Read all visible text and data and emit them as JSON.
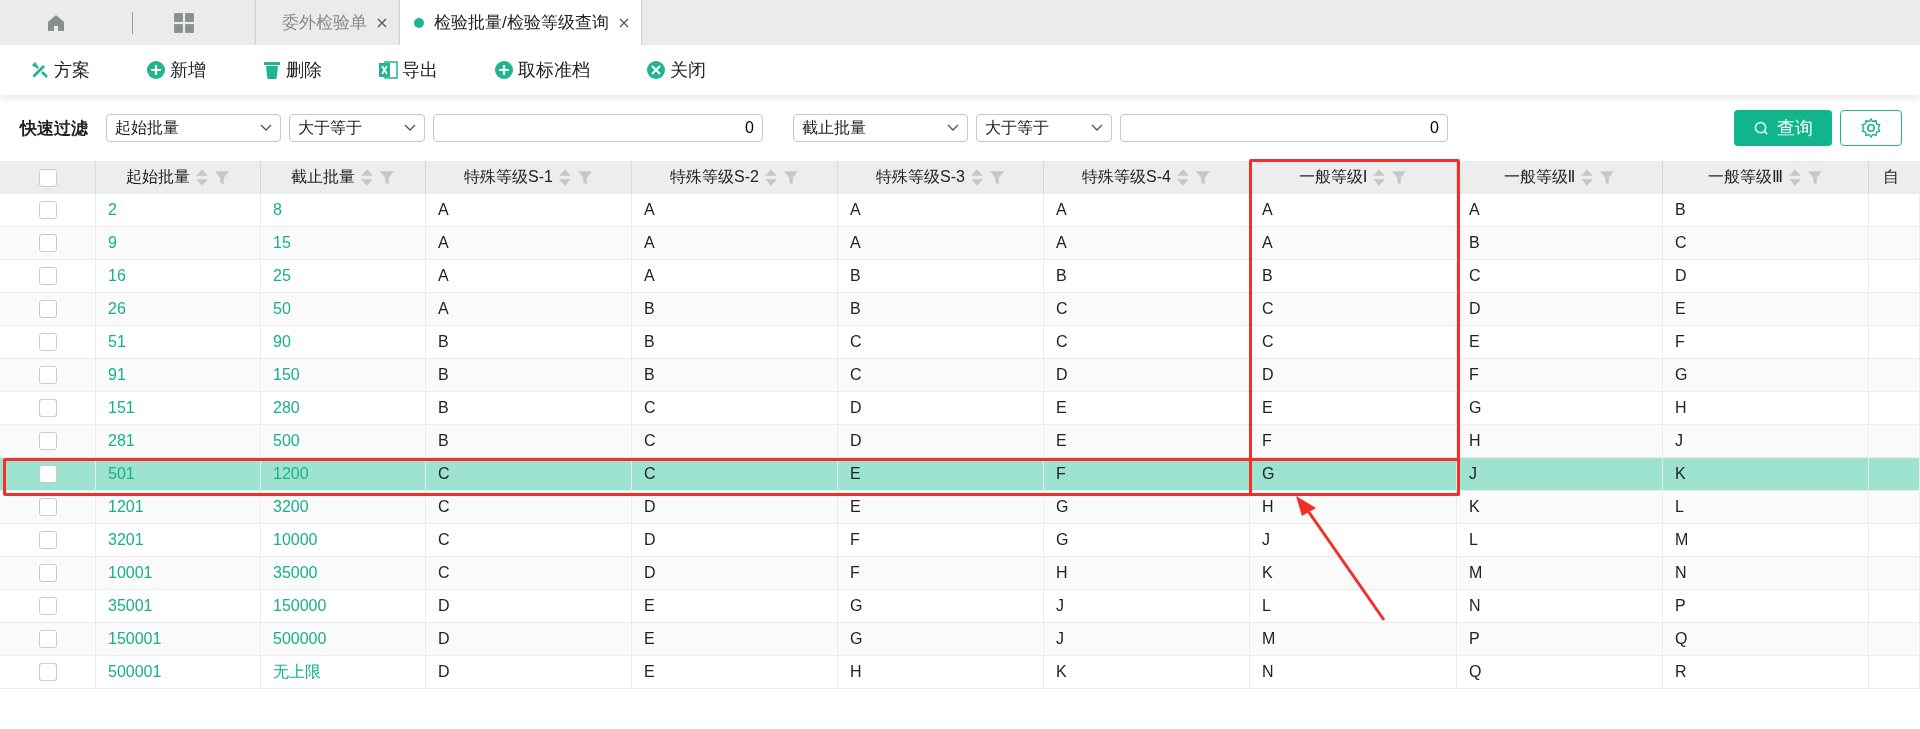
{
  "tabs": [
    {
      "label": "委外检验单",
      "selected": false
    },
    {
      "label": "检验批量/检验等级查询",
      "selected": true
    }
  ],
  "toolbar": [
    {
      "label": "方案",
      "kind": "scheme"
    },
    {
      "label": "新增",
      "kind": "add"
    },
    {
      "label": "删除",
      "kind": "delete"
    },
    {
      "label": "导出",
      "kind": "export"
    },
    {
      "label": "取标准档",
      "kind": "add"
    },
    {
      "label": "关闭",
      "kind": "close"
    }
  ],
  "filter": {
    "label": "快速过滤",
    "conditions": [
      {
        "field": "起始批量",
        "operator": "大于等于",
        "value": "0"
      },
      {
        "field": "截止批量",
        "operator": "大于等于",
        "value": "0"
      }
    ],
    "query_button": "查询"
  },
  "table": {
    "columns": [
      {
        "label": "起始批量",
        "sortable": true
      },
      {
        "label": "截止批量",
        "sortable": true
      },
      {
        "label": "特殊等级S-1",
        "sortable": true
      },
      {
        "label": "特殊等级S-2",
        "sortable": true
      },
      {
        "label": "特殊等级S-3",
        "sortable": true
      },
      {
        "label": "特殊等级S-4",
        "sortable": true
      },
      {
        "label": "一般等级Ⅰ",
        "sortable": true
      },
      {
        "label": "一般等级Ⅱ",
        "sortable": true
      },
      {
        "label": "一般等级Ⅲ",
        "sortable": true
      },
      {
        "label": "自",
        "sortable": false
      }
    ],
    "all_checked": false,
    "rows": [
      {
        "cells": [
          "2",
          "8",
          "A",
          "A",
          "A",
          "A",
          "A",
          "A",
          "B"
        ],
        "selected": false,
        "checked": false
      },
      {
        "cells": [
          "9",
          "15",
          "A",
          "A",
          "A",
          "A",
          "A",
          "B",
          "C"
        ],
        "selected": false,
        "checked": false
      },
      {
        "cells": [
          "16",
          "25",
          "A",
          "A",
          "B",
          "B",
          "B",
          "C",
          "D"
        ],
        "selected": false,
        "checked": false
      },
      {
        "cells": [
          "26",
          "50",
          "A",
          "B",
          "B",
          "C",
          "C",
          "D",
          "E"
        ],
        "selected": false,
        "checked": false
      },
      {
        "cells": [
          "51",
          "90",
          "B",
          "B",
          "C",
          "C",
          "C",
          "E",
          "F"
        ],
        "selected": false,
        "checked": false
      },
      {
        "cells": [
          "91",
          "150",
          "B",
          "B",
          "C",
          "D",
          "D",
          "F",
          "G"
        ],
        "selected": false,
        "checked": false
      },
      {
        "cells": [
          "151",
          "280",
          "B",
          "C",
          "D",
          "E",
          "E",
          "G",
          "H"
        ],
        "selected": false,
        "checked": false
      },
      {
        "cells": [
          "281",
          "500",
          "B",
          "C",
          "D",
          "E",
          "F",
          "H",
          "J"
        ],
        "selected": false,
        "checked": false
      },
      {
        "cells": [
          "501",
          "1200",
          "C",
          "C",
          "E",
          "F",
          "G",
          "J",
          "K"
        ],
        "selected": true,
        "checked": false
      },
      {
        "cells": [
          "1201",
          "3200",
          "C",
          "D",
          "E",
          "G",
          "H",
          "K",
          "L"
        ],
        "selected": false,
        "checked": false
      },
      {
        "cells": [
          "3201",
          "10000",
          "C",
          "D",
          "F",
          "G",
          "J",
          "L",
          "M"
        ],
        "selected": false,
        "checked": false
      },
      {
        "cells": [
          "10001",
          "35000",
          "C",
          "D",
          "F",
          "H",
          "K",
          "M",
          "N"
        ],
        "selected": false,
        "checked": false
      },
      {
        "cells": [
          "35001",
          "150000",
          "D",
          "E",
          "G",
          "J",
          "L",
          "N",
          "P"
        ],
        "selected": false,
        "checked": false
      },
      {
        "cells": [
          "150001",
          "500000",
          "D",
          "E",
          "G",
          "J",
          "M",
          "P",
          "Q"
        ],
        "selected": false,
        "checked": false
      },
      {
        "cells": [
          "500001",
          "无上限",
          "D",
          "E",
          "H",
          "K",
          "N",
          "Q",
          "R"
        ],
        "selected": false,
        "checked": false
      }
    ]
  }
}
